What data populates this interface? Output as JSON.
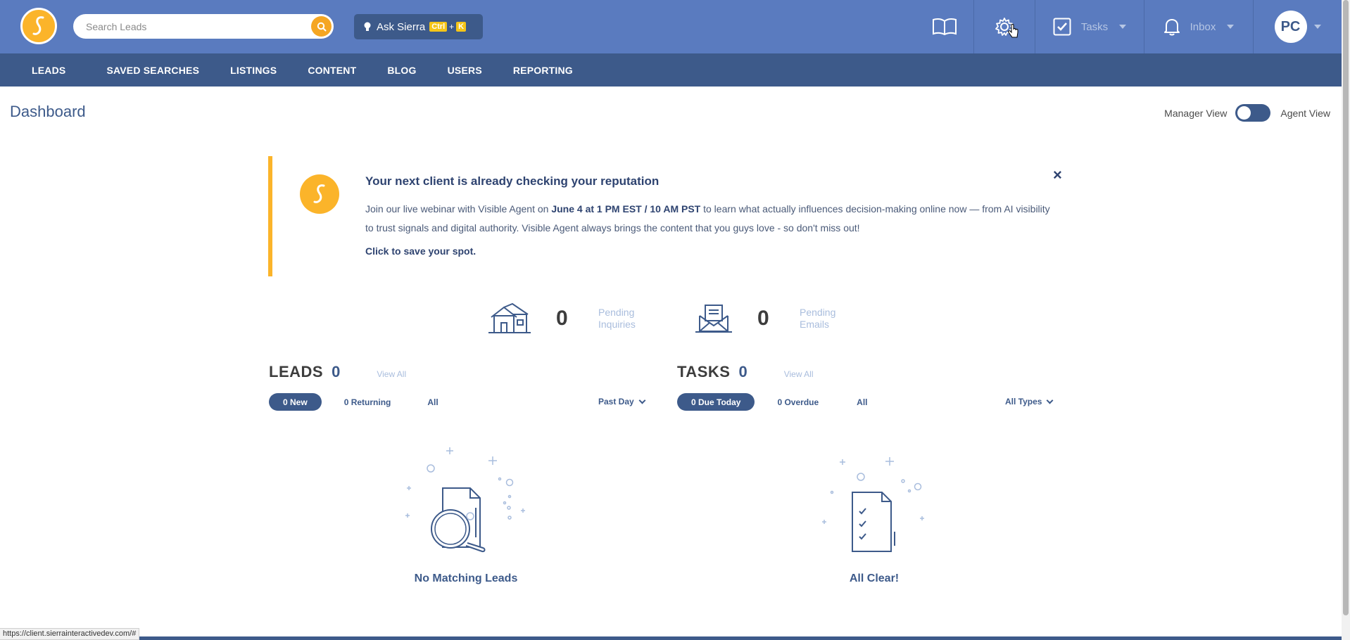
{
  "header": {
    "search_placeholder": "Search Leads",
    "ask_label": "Ask Sierra",
    "shortcut_ctrl": "Ctrl",
    "shortcut_plus": "+",
    "shortcut_key": "K",
    "tasks_label": "Tasks",
    "inbox_label": "Inbox",
    "user_initials": "PC"
  },
  "nav": {
    "items": [
      "LEADS",
      "SAVED SEARCHES",
      "LISTINGS",
      "CONTENT",
      "BLOG",
      "USERS",
      "REPORTING"
    ]
  },
  "page": {
    "title": "Dashboard",
    "manager_view": "Manager View",
    "agent_view": "Agent View"
  },
  "banner": {
    "title": "Your next client is already checking your reputation",
    "body_pre": "Join our live webinar with Visible Agent on ",
    "body_bold": "June 4 at 1 PM EST / 10 AM PST",
    "body_post": " to learn what actually influences decision-making online now — from AI visibility to trust signals and digital authority. Visible Agent always brings the content that you guys love - so don't miss out!",
    "cta": "Click to save your spot.",
    "close": "×"
  },
  "stats": {
    "inquiries_count": "0",
    "inquiries_label_1": "Pending",
    "inquiries_label_2": "Inquiries",
    "emails_count": "0",
    "emails_label_1": "Pending",
    "emails_label_2": "Emails"
  },
  "leads": {
    "title": "LEADS",
    "count": "0",
    "view_all": "View All",
    "filter_new": "0 New",
    "filter_returning": "0 Returning",
    "filter_all": "All",
    "period": "Past Day",
    "empty": "No Matching Leads"
  },
  "tasks": {
    "title": "TASKS",
    "count": "0",
    "view_all": "View All",
    "filter_due": "0 Due Today",
    "filter_overdue": "0 Overdue",
    "filter_all": "All",
    "types": "All Types",
    "empty": "All Clear!"
  },
  "status_bar": {
    "url": "https://client.sierrainteractivedev.com/#"
  },
  "colors": {
    "topbar": "#5a7bbf",
    "navbar": "#3d5a8a",
    "accent": "#fbb42a"
  }
}
